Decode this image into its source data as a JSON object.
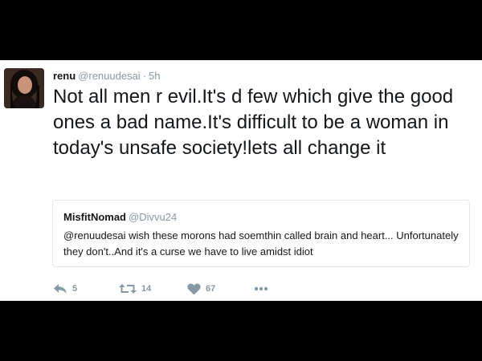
{
  "tweet": {
    "author_name": "renu",
    "author_handle": "@renuudesai",
    "separator": "·",
    "time": "5h",
    "text": "Not all men r evil.It's d few which give the good ones a bad name.It's difficult to be a woman in today's unsafe society!lets all change it"
  },
  "quoted_tweet": {
    "author_name": "MisfitNomad",
    "author_handle": "@Divvu24",
    "text": "@renuudesai wish these morons had soemthin called brain and heart... Unfortunately they don't..And it's a curse we have to live amidst idiot"
  },
  "actions": {
    "reply_icon": "reply-icon",
    "reply_count": "5",
    "retweet_icon": "retweet-icon",
    "retweet_count": "14",
    "like_icon": "heart-icon",
    "like_count": "67",
    "more_icon": "more-icon"
  },
  "colors": {
    "background": "#000000",
    "card": "#ffffff",
    "text": "#14171a",
    "secondary": "#8899a6",
    "border": "#e1e8ed"
  }
}
